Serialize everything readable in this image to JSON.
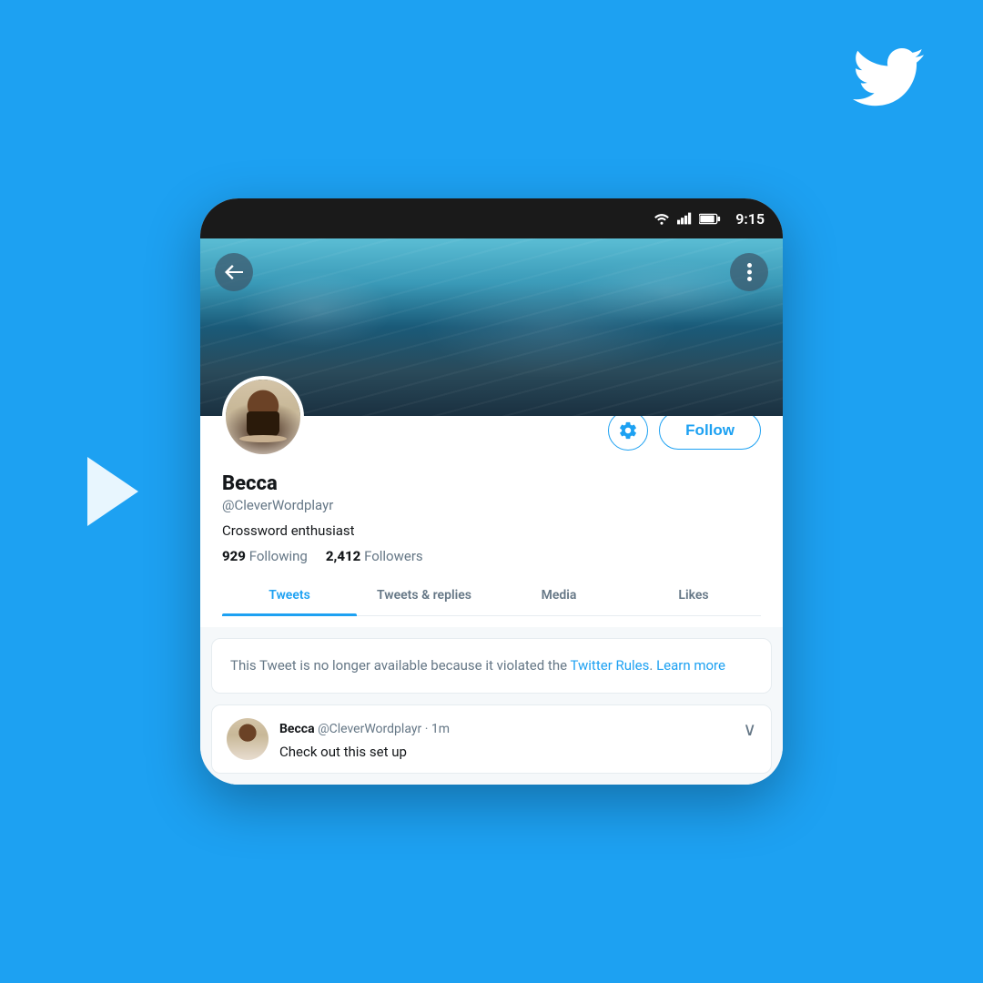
{
  "background_color": "#1DA1F2",
  "twitter_logo": "twitter-bird",
  "status_bar": {
    "time": "9:15",
    "wifi": true,
    "signal": true,
    "battery": true
  },
  "cover": {
    "back_btn": "←",
    "more_btn": "⋮"
  },
  "profile": {
    "display_name": "Becca",
    "username": "@CleverWordplayr",
    "bio": "Crossword enthusiast",
    "following_count": "929",
    "following_label": "Following",
    "followers_count": "2,412",
    "followers_label": "Followers",
    "follow_btn": "Follow",
    "settings_btn": "⚙"
  },
  "tabs": [
    {
      "label": "Tweets",
      "active": true
    },
    {
      "label": "Tweets & replies",
      "active": false
    },
    {
      "label": "Media",
      "active": false
    },
    {
      "label": "Likes",
      "active": false
    }
  ],
  "notice_card": {
    "text_before": "This Tweet is no longer available because it violated the ",
    "link1": "Twitter Rules",
    "text_mid": ". ",
    "link2": "Learn more"
  },
  "tweet": {
    "author_name": "Becca",
    "author_handle": "@CleverWordplayr",
    "time": "1m",
    "text": "Check out this set up",
    "expand_icon": "∨"
  }
}
